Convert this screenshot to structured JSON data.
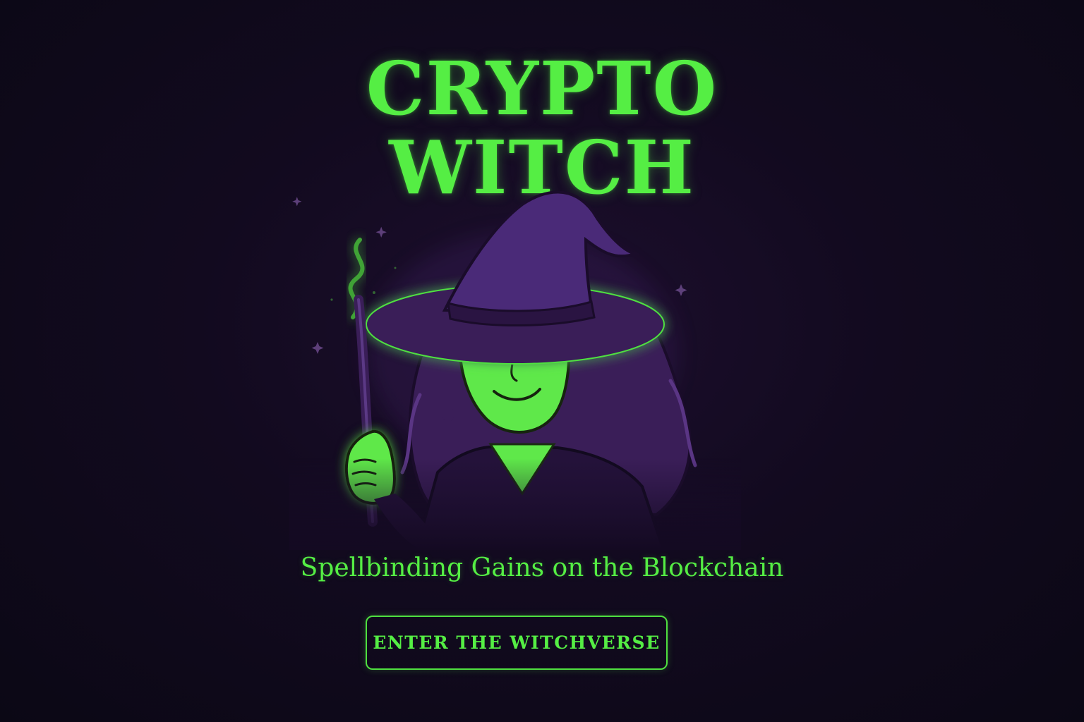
{
  "hero": {
    "title_line_1": "CRYPTO",
    "title_line_2": "WITCH",
    "tagline": "Spellbinding Gains on the Blockchain",
    "cta_label": "ENTER THE WITCHVERSE"
  },
  "illustration": {
    "subject": "witch-with-wand",
    "sparkle_icon": "sparkle-icon"
  },
  "colors": {
    "background": "#120a1f",
    "accent_green": "#55ee44",
    "witch_purple": "#3b1f5c",
    "hat_purple": "#4a2a78",
    "skin_green": "#5fe84a"
  }
}
